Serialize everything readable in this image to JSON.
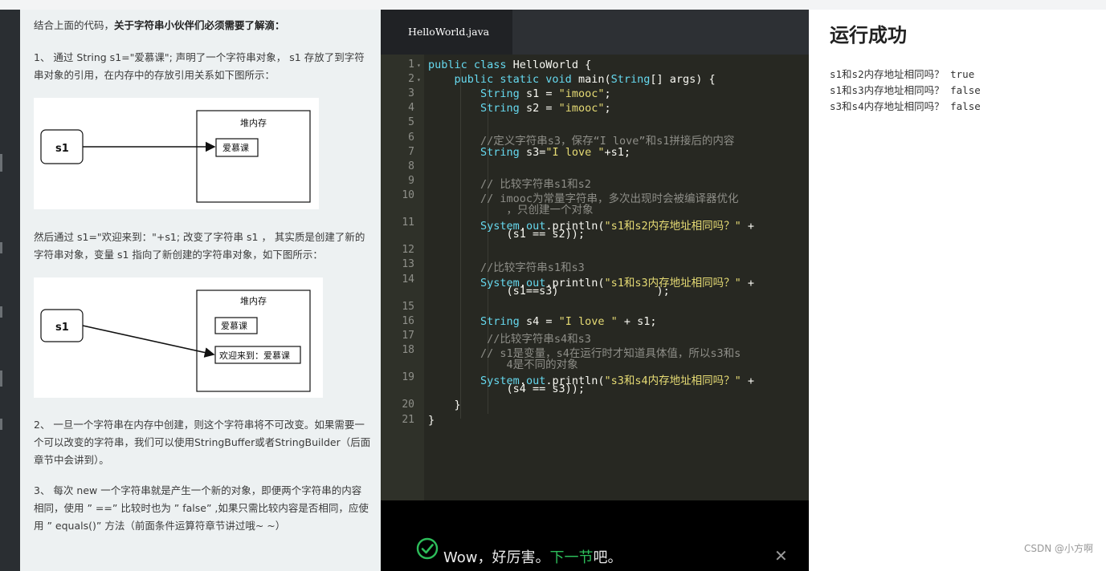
{
  "lesson": {
    "intro_plain": "结合上面的代码，",
    "intro_bold": "关于字符串小伙伴们必须需要了解滴：",
    "para1": "1、 通过 String s1=\"爱慕课\"; 声明了一个字符串对象， s1 存放了到字符串对象的引用，在内存中的存放引用关系如下图所示：",
    "para2": "然后通过 s1=\"欢迎来到：\"+s1; 改变了字符串 s1 ， 其实质是创建了新的字符串对象，变量 s1 指向了新创建的字符串对象，如下图所示：",
    "para3": "2、 一旦一个字符串在内存中创建，则这个字符串将不可改变。如果需要一个可以改变的字符串，我们可以使用StringBuffer或者StringBuilder（后面章节中会讲到）。",
    "para4": "3、 每次 new 一个字符串就是产生一个新的对象，即便两个字符串的内容相同，使用 ” ==” 比较时也为 ” false” ,如果只需比较内容是否相同，应使用 ” equals()” 方法（前面条件运算符章节讲过哦~ ~）",
    "diagram1": {
      "heap_label": "堆内存",
      "var_label": "s1",
      "obj_label": "爱慕课"
    },
    "diagram2": {
      "heap_label": "堆内存",
      "var_label": "s1",
      "obj1_label": "爱慕课",
      "obj2_label": "欢迎来到：爱慕课"
    }
  },
  "editor": {
    "tab_label": "HelloWorld.java",
    "lines": [
      {
        "n": "1",
        "fold": true,
        "segs": [
          {
            "c": "kw",
            "t": "public class "
          },
          {
            "c": "pl",
            "t": "HelloWorld {"
          }
        ]
      },
      {
        "n": "2",
        "fold": true,
        "segs": [
          {
            "c": "pl",
            "t": "    "
          },
          {
            "c": "kw",
            "t": "public static void "
          },
          {
            "c": "pl",
            "t": "main("
          },
          {
            "c": "kw",
            "t": "String"
          },
          {
            "c": "pl",
            "t": "[] args) {"
          }
        ]
      },
      {
        "n": "3",
        "segs": [
          {
            "c": "pl",
            "t": "        "
          },
          {
            "c": "kw",
            "t": "String"
          },
          {
            "c": "pl",
            "t": " s1 = "
          },
          {
            "c": "st",
            "t": "\"imooc\""
          },
          {
            "c": "pl",
            "t": ";"
          }
        ]
      },
      {
        "n": "4",
        "segs": [
          {
            "c": "pl",
            "t": "        "
          },
          {
            "c": "kw",
            "t": "String"
          },
          {
            "c": "pl",
            "t": " s2 = "
          },
          {
            "c": "st",
            "t": "\"imooc\""
          },
          {
            "c": "pl",
            "t": ";"
          }
        ]
      },
      {
        "n": "5",
        "segs": []
      },
      {
        "n": "6",
        "segs": [
          {
            "c": "pl",
            "t": "        "
          },
          {
            "c": "cm",
            "t": "//定义字符串s3，保存“I love”和s1拼接后的内容"
          }
        ]
      },
      {
        "n": "7",
        "segs": [
          {
            "c": "pl",
            "t": "        "
          },
          {
            "c": "kw",
            "t": "String"
          },
          {
            "c": "pl",
            "t": " s3="
          },
          {
            "c": "st",
            "t": "\"I love \""
          },
          {
            "c": "pl",
            "t": "+s1;"
          }
        ]
      },
      {
        "n": "8",
        "segs": []
      },
      {
        "n": "9",
        "segs": [
          {
            "c": "pl",
            "t": "        "
          },
          {
            "c": "cm",
            "t": "// 比较字符串s1和s2"
          }
        ]
      },
      {
        "n": "10",
        "segs": [
          {
            "c": "pl",
            "t": "        "
          },
          {
            "c": "cm",
            "t": "// imooc为常量字符串，多次出现时会被编译器优化"
          }
        ],
        "cont": [
          {
            "c": "cm",
            "t": "            ，只创建一个对象"
          }
        ]
      },
      {
        "n": "11",
        "segs": [
          {
            "c": "pl",
            "t": "        "
          },
          {
            "c": "kw",
            "t": "System"
          },
          {
            "c": "pl",
            "t": "."
          },
          {
            "c": "kw",
            "t": "out"
          },
          {
            "c": "pl",
            "t": ".println("
          },
          {
            "c": "st",
            "t": "\"s1和s2内存地址相同吗？\""
          },
          {
            "c": "pl",
            "t": " +"
          }
        ],
        "cont": [
          {
            "c": "pl",
            "t": "            (s1 == s2));"
          }
        ]
      },
      {
        "n": "12",
        "segs": []
      },
      {
        "n": "13",
        "segs": [
          {
            "c": "pl",
            "t": "        "
          },
          {
            "c": "cm",
            "t": "//比较字符串s1和s3"
          }
        ]
      },
      {
        "n": "14",
        "segs": [
          {
            "c": "pl",
            "t": "        "
          },
          {
            "c": "kw",
            "t": "System"
          },
          {
            "c": "pl",
            "t": "."
          },
          {
            "c": "kw",
            "t": "out"
          },
          {
            "c": "pl",
            "t": ".println("
          },
          {
            "c": "st",
            "t": "\"s1和s3内存地址相同吗？\""
          },
          {
            "c": "pl",
            "t": " +"
          }
        ],
        "cont": [
          {
            "c": "pl",
            "t": "            (s1==s3)               );"
          }
        ]
      },
      {
        "n": "15",
        "segs": []
      },
      {
        "n": "16",
        "segs": [
          {
            "c": "pl",
            "t": "        "
          },
          {
            "c": "kw",
            "t": "String"
          },
          {
            "c": "pl",
            "t": " s4 = "
          },
          {
            "c": "st",
            "t": "\"I love \""
          },
          {
            "c": "pl",
            "t": " + s1;"
          }
        ]
      },
      {
        "n": "17",
        "segs": [
          {
            "c": "pl",
            "t": "         "
          },
          {
            "c": "cm",
            "t": "//比较字符串s4和s3"
          }
        ]
      },
      {
        "n": "18",
        "segs": [
          {
            "c": "pl",
            "t": "        "
          },
          {
            "c": "cm",
            "t": "// s1是变量，s4在运行时才知道具体值，所以s3和s"
          }
        ],
        "cont": [
          {
            "c": "cm",
            "t": "            4是不同的对象"
          }
        ]
      },
      {
        "n": "19",
        "segs": [
          {
            "c": "pl",
            "t": "        "
          },
          {
            "c": "kw",
            "t": "System"
          },
          {
            "c": "pl",
            "t": "."
          },
          {
            "c": "kw",
            "t": "out"
          },
          {
            "c": "pl",
            "t": ".println("
          },
          {
            "c": "st",
            "t": "\"s3和s4内存地址相同吗？\""
          },
          {
            "c": "pl",
            "t": " +"
          }
        ],
        "cont": [
          {
            "c": "pl",
            "t": "            (s4 == s3));"
          }
        ]
      },
      {
        "n": "20",
        "segs": [
          {
            "c": "pl",
            "t": "    }"
          }
        ]
      },
      {
        "n": "21",
        "segs": [
          {
            "c": "pl",
            "t": "}"
          }
        ]
      }
    ]
  },
  "toast": {
    "text_before": "Wow，好厉害。",
    "next_link": "下一节",
    "text_after": "吧。",
    "close_icon": "close-icon"
  },
  "result": {
    "title": "运行成功",
    "output": [
      "s1和s2内存地址相同吗？ true",
      "s1和s3内存地址相同吗？ false",
      "s3和s4内存地址相同吗？ false"
    ]
  },
  "watermark": "CSDN @小方啊"
}
